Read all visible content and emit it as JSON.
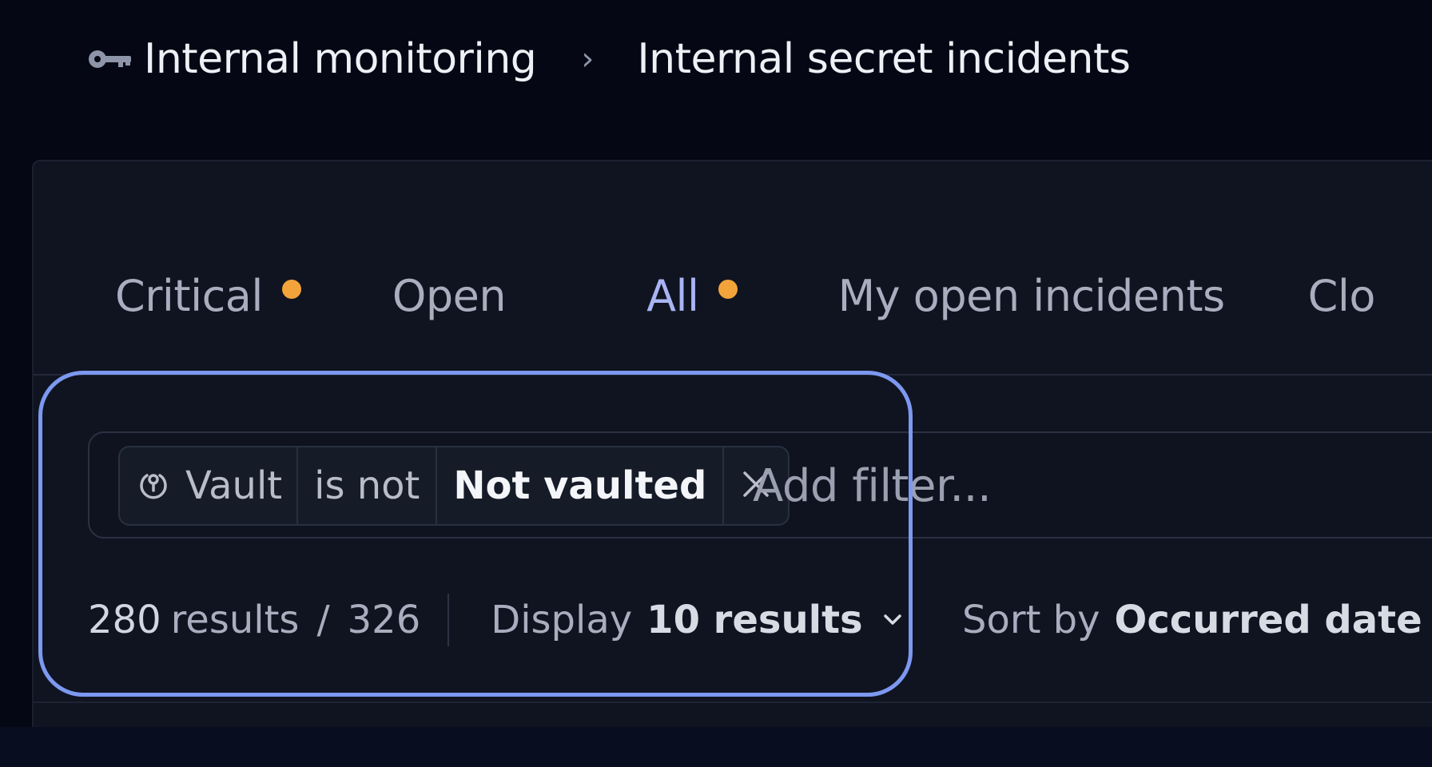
{
  "breadcrumb": {
    "icon": "key-icon",
    "parent": "Internal monitoring",
    "separator": "›",
    "current": "Internal secret incidents"
  },
  "tabs": [
    {
      "label": "Critical",
      "has_dot": true
    },
    {
      "label": "Open",
      "has_dot": false
    },
    {
      "label": "All",
      "has_dot": true,
      "active": true
    },
    {
      "label": "My open incidents",
      "has_dot": false
    },
    {
      "label": "Clo",
      "has_dot": false
    }
  ],
  "filter": {
    "chip": {
      "icon": "vault-icon",
      "field": "Vault",
      "operator": "is not",
      "value": "Not vaulted",
      "remove_icon": "close-icon"
    },
    "placeholder": "Add filter..."
  },
  "results": {
    "count": "280",
    "count_label": "results",
    "slash": "/",
    "total": "326",
    "display_label": "Display",
    "display_value": "10 results",
    "sort_label": "Sort by",
    "sort_value": "Occurred date"
  },
  "colors": {
    "background": "#050814",
    "panel": "#101421",
    "accent_dot": "#f2a33a",
    "active_tab": "#a9b4f4",
    "highlight": "#7d98f0"
  }
}
